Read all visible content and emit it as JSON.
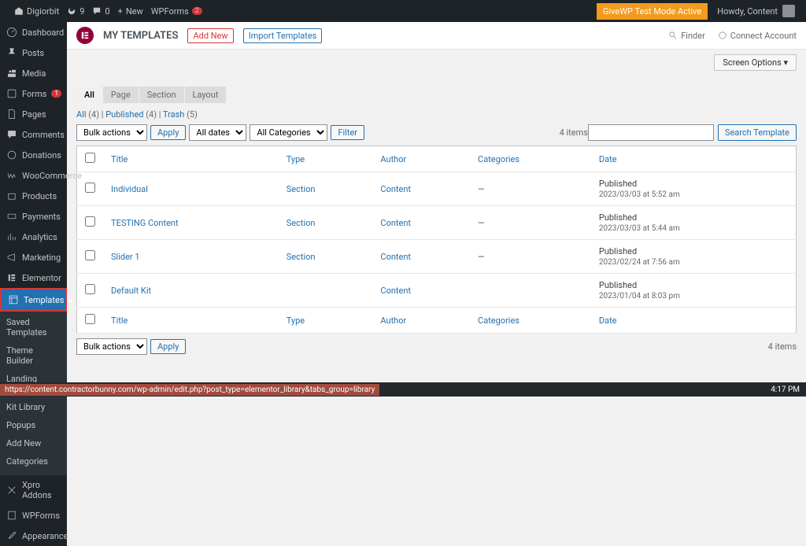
{
  "adminbar": {
    "site": "Digiorbit",
    "updates": "9",
    "comments": "0",
    "new": "New",
    "wpforms": "WPForms",
    "wpforms_badge": "2",
    "give_test": "GiveWP Test Mode Active",
    "howdy": "Howdy, Content"
  },
  "sidebar": {
    "items": [
      {
        "label": "Dashboard"
      },
      {
        "label": "Posts"
      },
      {
        "label": "Media"
      },
      {
        "label": "Forms",
        "badge": "1"
      },
      {
        "label": "Pages"
      },
      {
        "label": "Comments"
      },
      {
        "label": "Donations"
      },
      {
        "label": "WooCommerce"
      },
      {
        "label": "Products"
      },
      {
        "label": "Payments"
      },
      {
        "label": "Analytics"
      },
      {
        "label": "Marketing"
      },
      {
        "label": "Elementor"
      },
      {
        "label": "Templates"
      },
      {
        "label": "Xpro Addons"
      },
      {
        "label": "WPForms"
      },
      {
        "label": "Appearance"
      }
    ],
    "submenu": {
      "items": [
        "Saved Templates",
        "Theme Builder",
        "Landing Pages",
        "Kit Library",
        "Popups",
        "Add New",
        "Categories"
      ]
    }
  },
  "header": {
    "title": "MY TEMPLATES",
    "add_new": "Add New",
    "import": "Import Templates",
    "finder": "Finder",
    "connect": "Connect Account"
  },
  "screen_options": "Screen Options",
  "tabs": [
    "All",
    "Page",
    "Section",
    "Layout"
  ],
  "subsubsub": {
    "all": "All",
    "all_count": "(4)",
    "published": "Published",
    "published_count": "(4)",
    "trash": "Trash",
    "trash_count": "(5)"
  },
  "filters": {
    "bulk": "Bulk actions",
    "apply": "Apply",
    "dates": "All dates",
    "categories": "All Categories",
    "filter": "Filter",
    "count": "4 items",
    "search_btn": "Search Template"
  },
  "table": {
    "cols": {
      "title": "Title",
      "type": "Type",
      "author": "Author",
      "categories": "Categories",
      "date": "Date"
    },
    "rows": [
      {
        "title": "Individual",
        "type": "Section",
        "author": "Content",
        "categories": "—",
        "date_status": "Published",
        "date": "2023/03/03 at 5:52 am"
      },
      {
        "title": "TESTING Content",
        "type": "Section",
        "author": "Content",
        "categories": "—",
        "date_status": "Published",
        "date": "2023/03/03 at 5:44 am"
      },
      {
        "title": "Slider 1",
        "type": "Section",
        "author": "Content",
        "categories": "—",
        "date_status": "Published",
        "date": "2023/02/24 at 7:56 am"
      },
      {
        "title": "Default Kit",
        "type": "",
        "author": "Content",
        "categories": "",
        "date_status": "Published",
        "date": "2023/01/04 at 8:03 pm"
      }
    ]
  },
  "statusbar": {
    "url": "https://content.contractorbunny.com/wp-admin/edit.php?post_type=elementor_library&tabs_group=library",
    "time": "4:17 PM"
  }
}
